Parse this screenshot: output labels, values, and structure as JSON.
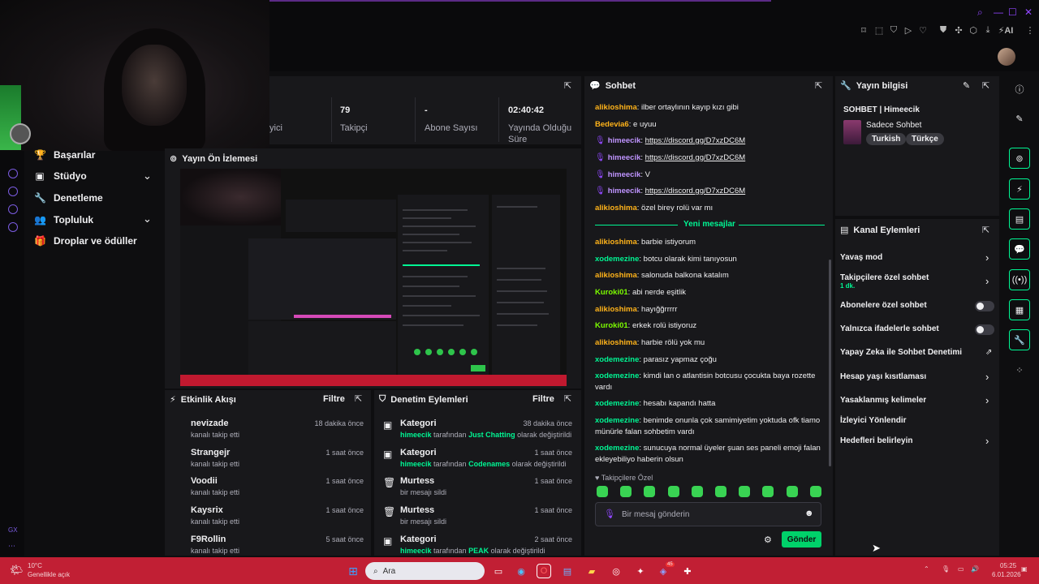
{
  "browser": {
    "ai_label": "AI"
  },
  "sidebar": {
    "items": [
      {
        "label": "Başarılar",
        "icon": "trophy-icon"
      },
      {
        "label": "Stüdyo",
        "icon": "studio-icon"
      },
      {
        "label": "Denetleme",
        "icon": "wrench-icon"
      },
      {
        "label": "Topluluk",
        "icon": "community-icon"
      },
      {
        "label": "Droplar ve ödüller",
        "icon": "gift-icon"
      }
    ],
    "gx_label": "GX"
  },
  "stats": [
    {
      "value": "",
      "label": "yici"
    },
    {
      "value": "79",
      "label": "Takipçi"
    },
    {
      "value": "-",
      "label": "Abone Sayısı"
    },
    {
      "value": "02:40:42",
      "label": "Yayında Olduğu Süre"
    }
  ],
  "preview": {
    "title": "Yayın Ön İzlemesi"
  },
  "activity": {
    "title": "Etkinlik Akışı",
    "filter": "Filtre",
    "items": [
      {
        "name": "nevizade",
        "action": "kanalı takip etti",
        "time": "18 dakika önce"
      },
      {
        "name": "Strangejr",
        "action": "kanalı takip etti",
        "time": "1 saat önce"
      },
      {
        "name": "Voodii",
        "action": "kanalı takip etti",
        "time": "1 saat önce"
      },
      {
        "name": "Kaysrix",
        "action": "kanalı takip etti",
        "time": "1 saat önce"
      },
      {
        "name": "F9Rollin",
        "action": "kanalı takip etti",
        "time": "5 saat önce"
      }
    ]
  },
  "moderation": {
    "title": "Denetim Eylemleri",
    "filter": "Filtre",
    "items": [
      {
        "title": "Kategori",
        "time": "38 dakika önce",
        "user": "himeecik",
        "mid": " tarafından ",
        "target": "Just Chatting",
        "end": " olarak değiştirildi"
      },
      {
        "title": "Kategori",
        "time": "1 saat önce",
        "user": "himeecik",
        "mid": " tarafından ",
        "target": "Codenames",
        "end": " olarak değiştirildi"
      },
      {
        "title": "Murtess",
        "time": "1 saat önce",
        "sub": "bir mesajı sildi"
      },
      {
        "title": "Murtess",
        "time": "1 saat önce",
        "sub": "bir mesajı sildi"
      },
      {
        "title": "Kategori",
        "time": "2 saat önce",
        "user": "himeecik",
        "mid": " tarafından ",
        "target": "PEAK",
        "end": " olarak değiştirildi"
      }
    ]
  },
  "chat": {
    "title": "Sohbet",
    "new_messages": "Yeni mesajlar",
    "messages_before": [
      {
        "user": "alikioshima",
        "color": "#ffb31a",
        "text": "ilber ortaylının kayıp kızı gibi"
      },
      {
        "user": "Bedevia6",
        "color": "#ffb31a",
        "text": "e uyuu"
      },
      {
        "user": "himeecik",
        "color": "#bf94ff",
        "text": "https://discord.gg/D7xzDC6M",
        "link": true,
        "badge": true
      },
      {
        "user": "himeecik",
        "color": "#bf94ff",
        "text": "https://discord.gg/D7xzDC6M",
        "link": true,
        "badge": true
      },
      {
        "user": "himeecik",
        "color": "#bf94ff",
        "text": "V",
        "badge": true
      },
      {
        "user": "himeecik",
        "color": "#bf94ff",
        "text": "https://discord.gg/D7xzDC6M",
        "link": true,
        "badge": true
      },
      {
        "user": "alikioshima",
        "color": "#ffb31a",
        "text": "özel birey rolü var mı"
      }
    ],
    "messages_after": [
      {
        "user": "alikioshima",
        "color": "#ffb31a",
        "text": "barbie istiyorum"
      },
      {
        "user": "xodemezine",
        "color": "#00f593",
        "text": "botcu olarak kimi tanıyosun"
      },
      {
        "user": "alikioshima",
        "color": "#ffb31a",
        "text": "salonuda balkona katalım"
      },
      {
        "user": "Kuroki01",
        "color": "#7cfc00",
        "text": "abi nerde eşitlik"
      },
      {
        "user": "alikioshima",
        "color": "#ffb31a",
        "text": "hayığğrrrrr"
      },
      {
        "user": "Kuroki01",
        "color": "#7cfc00",
        "text": "erkek rolü istiyoruz"
      },
      {
        "user": "alikioshima",
        "color": "#ffb31a",
        "text": "harbie rölü yok mu"
      },
      {
        "user": "xodemezine",
        "color": "#00f593",
        "text": "parasız yapmaz çoğu"
      },
      {
        "user": "xodemezine",
        "color": "#00f593",
        "text": "kimdi lan o atlantisin botcusu çocukta baya rozette vardı"
      },
      {
        "user": "xodemezine",
        "color": "#00f593",
        "text": "hesabı kapandı hatta"
      },
      {
        "user": "xodemezine",
        "color": "#00f593",
        "text": "benimde onunla çok samimiyetim yoktuda ofk tiamo münürle falan sohbetim vardı"
      },
      {
        "user": "xodemezine",
        "color": "#00f593",
        "text": "sunucuya normal üyeler şuan ses paneli emoji falan ekleyebiliyo haberin olsun"
      }
    ],
    "followers_label": "Takipçilere Özel",
    "input_placeholder": "Bir mesaj gönderin",
    "send_label": "Gönder"
  },
  "stream_info": {
    "title": "Yayın bilgisi",
    "stream_title": "SOHBET | Himeecik",
    "category": "Sadece Sohbet",
    "tags": [
      "Turkish",
      "Türkçe"
    ]
  },
  "channel_actions": {
    "title": "Kanal Eylemleri",
    "items": [
      {
        "label": "Yavaş mod",
        "type": "arrow"
      },
      {
        "label": "Takipçilere özel sohbet",
        "sub": "1 dk.",
        "type": "arrow"
      },
      {
        "label": "Abonelere özel sohbet",
        "type": "toggle",
        "on": false
      },
      {
        "label": "Yalnızca ifadelerle sohbet",
        "type": "toggle",
        "on": false
      },
      {
        "label": "Yapay Zeka ile Sohbet Denetimi",
        "type": "external"
      },
      {
        "label": "Hesap yaşı kısıtlaması",
        "type": "arrow"
      },
      {
        "label": "Yasaklanmış kelimeler",
        "type": "arrow"
      },
      {
        "label": "İzleyici Yönlendir",
        "type": "none"
      },
      {
        "label": "Hedefleri belirleyin",
        "type": "arrow"
      }
    ]
  },
  "taskbar": {
    "weather_temp": "10°C",
    "weather_desc": "Genellikle açık",
    "search_placeholder": "Ara",
    "time": "05:25",
    "date": "6.01.2026",
    "discord_badge": "45"
  },
  "colors": {
    "accent": "#00f593",
    "purple": "#9147ff",
    "taskbar": "#c11f34",
    "panel": "#18181b"
  }
}
